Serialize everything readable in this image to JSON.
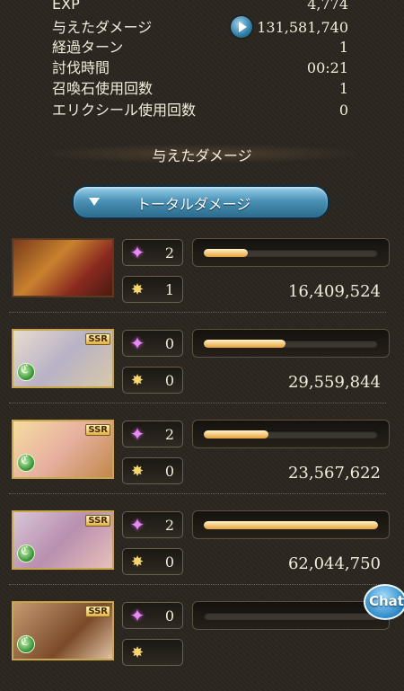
{
  "stats": {
    "exp": {
      "label": "EXP",
      "value": "4,774"
    },
    "damage": {
      "label": "与えたダメージ",
      "value": "131,581,740"
    },
    "turns": {
      "label": "経過ターン",
      "value": "1"
    },
    "time": {
      "label": "討伐時間",
      "value": "00:21"
    },
    "summons": {
      "label": "召喚石使用回数",
      "value": "1"
    },
    "elixir": {
      "label": "エリクシール使用回数",
      "value": "0"
    }
  },
  "section_title": "与えたダメージ",
  "dropdown": {
    "label": "トータルダメージ",
    "icon": "triangle-down-icon"
  },
  "characters": [
    {
      "portrait": "knights-portrait",
      "ssr": false,
      "element": "",
      "skill_count": "2",
      "ougi_count": "1",
      "damage": "16,409,524",
      "gauge_fraction": 0.25
    },
    {
      "portrait": "silver-hair-man-portrait",
      "ssr": true,
      "ssr_label": "SSR",
      "element": "wind",
      "skill_count": "0",
      "ougi_count": "0",
      "damage": "29,559,844",
      "gauge_fraction": 0.47
    },
    {
      "portrait": "blonde-girl-portrait",
      "ssr": true,
      "ssr_label": "SSR",
      "element": "wind",
      "skill_count": "2",
      "ougi_count": "0",
      "damage": "23,567,622",
      "gauge_fraction": 0.37
    },
    {
      "portrait": "pink-hair-girl-portrait",
      "ssr": true,
      "ssr_label": "SSR",
      "element": "wind",
      "skill_count": "2",
      "ougi_count": "0",
      "damage": "62,044,750",
      "gauge_fraction": 1.0
    },
    {
      "portrait": "brown-hair-man-portrait",
      "ssr": true,
      "ssr_label": "SSR",
      "element": "wind",
      "skill_count": "0",
      "ougi_count": "",
      "damage": "",
      "gauge_fraction": 0.0
    }
  ],
  "chat_button": {
    "label": "Chat"
  },
  "colors": {
    "gauge_fill": "#e4a23a",
    "accent_blue": "#4b92b6",
    "text": "#f3ecdc"
  }
}
